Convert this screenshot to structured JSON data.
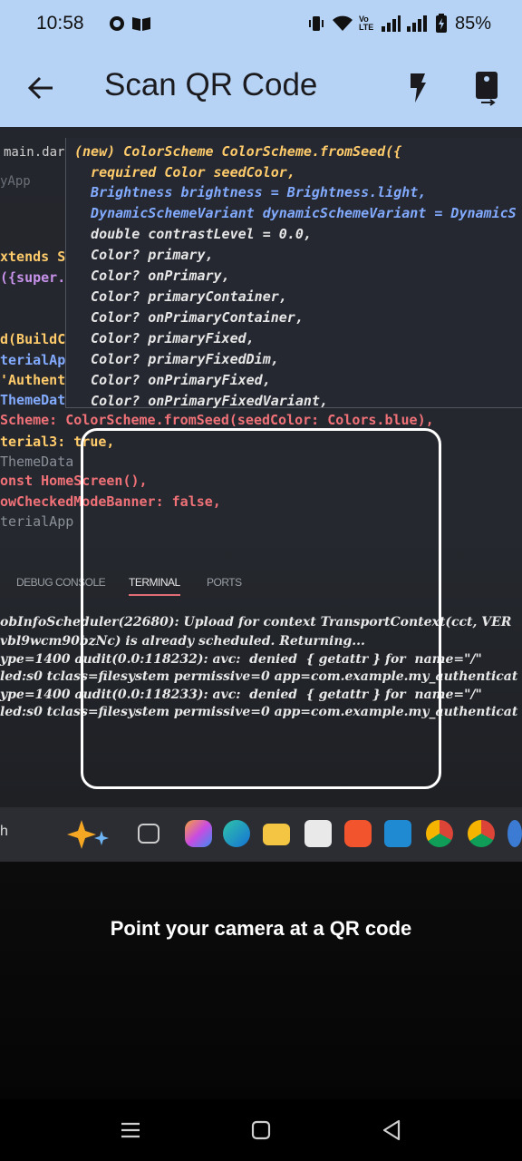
{
  "status": {
    "time": "10:58",
    "network_label": "Vo LTE",
    "battery": "85%"
  },
  "appbar": {
    "title": "Scan QR Code",
    "back_icon": "arrow-back-icon",
    "flash_icon": "flash-icon",
    "switch_camera_icon": "camera-switch-icon"
  },
  "preview": {
    "tab_file": "main.dart",
    "tab_sub": "yApp",
    "hover_lines": [
      "(new) ColorScheme ColorScheme.fromSeed({",
      "  required Color seedColor,",
      "  Brightness brightness = Brightness.light,",
      "  DynamicSchemeVariant dynamicSchemeVariant = DynamicS",
      "  double contrastLevel = 0.0,",
      "  Color? primary,",
      "  Color? onPrimary,",
      "  Color? primaryContainer,",
      "  Color? onPrimaryContainer,",
      "  Color? primaryFixed,",
      "  Color? primaryFixedDim,",
      "  Color? onPrimaryFixed,",
      "  Color? onPrimaryFixedVariant,"
    ],
    "left_lines": [
      "xtends S",
      "({super.",
      "d(BuildC",
      "terialAp",
      "'Authent",
      "ThemeDat"
    ],
    "code_lines": [
      "Scheme: ColorScheme.fromSeed(seedColor: Colors.blue),",
      "terial3: true,",
      "ThemeData",
      "onst HomeScreen(),",
      "owCheckedModeBanner: false,",
      "terialApp"
    ],
    "panel_tabs": [
      "DEBUG CONSOLE",
      "TERMINAL",
      "PORTS"
    ],
    "terminal_lines": [
      "obInfoScheduler(22680): Upload for context TransportContext(cct, VER",
      "vbl9wcm90bzNc) is already scheduled. Returning...",
      "ype=1400 audit(0.0:118232): avc:  denied  { getattr } for  name=\"/\"",
      "led:s0 tclass=filesystem permissive=0 app=com.example.my_authenticat",
      "ype=1400 audit(0.0:118233): avc:  denied  { getattr } for  name=\"/\"",
      "led:s0 tclass=filesystem permissive=0 app=com.example.my_authenticat"
    ],
    "taskbar_search": "h"
  },
  "hint": "Point your camera at a QR code",
  "navbar": {
    "menu_icon": "recent-apps-icon",
    "home_icon": "home-icon",
    "back_icon": "back-triangle-icon"
  }
}
